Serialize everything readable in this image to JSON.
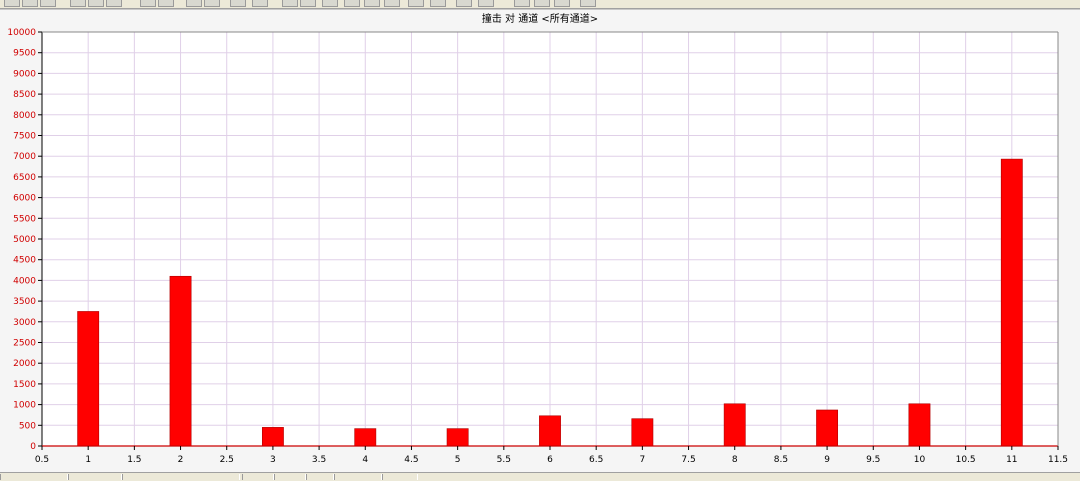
{
  "chart_data": {
    "type": "bar",
    "title": "撞击 对 通道 <所有通道>",
    "xlabel": "",
    "ylabel": "",
    "xlim": [
      0.5,
      11.5
    ],
    "ylim": [
      0,
      10000
    ],
    "x_ticks": [
      "0.5",
      "1",
      "1.5",
      "2",
      "2.5",
      "3",
      "3.5",
      "4",
      "4.5",
      "5",
      "5.5",
      "6",
      "6.5",
      "7",
      "7.5",
      "8",
      "8.5",
      "9",
      "9.5",
      "10",
      "10.5",
      "11",
      "11.5"
    ],
    "y_ticks": [
      "0",
      "500",
      "1000",
      "1500",
      "2000",
      "2500",
      "3000",
      "3500",
      "4000",
      "4500",
      "5000",
      "5500",
      "6000",
      "6500",
      "7000",
      "7500",
      "8000",
      "8500",
      "9000",
      "9500",
      "10000"
    ],
    "x": [
      1,
      2,
      3,
      4,
      5,
      6,
      7,
      8,
      9,
      10,
      11
    ],
    "values": [
      3250,
      4100,
      450,
      420,
      420,
      730,
      660,
      1020,
      870,
      1020,
      6930
    ],
    "bar_color": "#ff0000",
    "grid": true,
    "grid_color": "#e0d0e8"
  }
}
